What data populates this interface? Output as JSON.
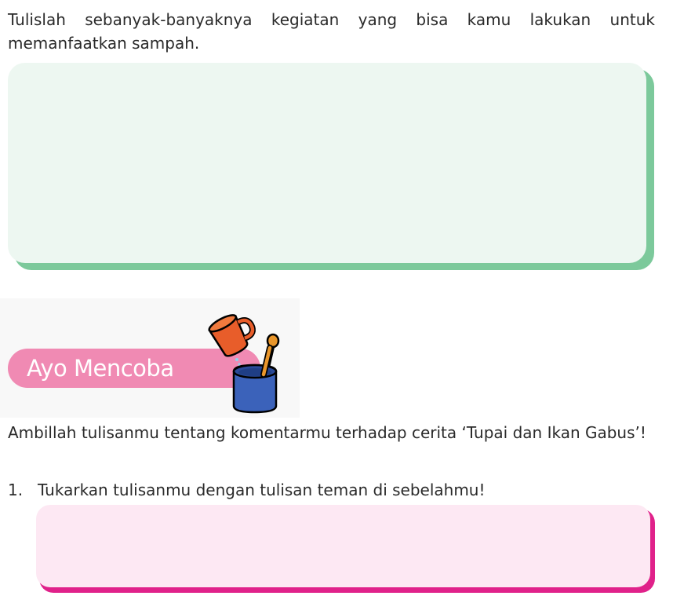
{
  "instructions": {
    "prompt_sampah": "Tulislah sebanyak-banyaknya kegiatan yang bisa kamu lakukan untuk memanfaatkan sampah."
  },
  "section": {
    "title": "Ayo Mencoba",
    "icon": "cups-icon",
    "colors": {
      "pill": "#f08ab3",
      "green_box": "#edf7f1",
      "green_border": "#7cc99b",
      "pink_box": "#fde8f3",
      "pink_border": "#e0218a"
    }
  },
  "activity": {
    "intro": "Ambillah tulisanmu tentang komentarmu terhadap cerita ‘Tupai dan Ikan Gabus’!",
    "steps": [
      {
        "number": "1.",
        "text": "Tukarkan tulisanmu dengan tulisan teman di sebelahmu!"
      }
    ]
  }
}
